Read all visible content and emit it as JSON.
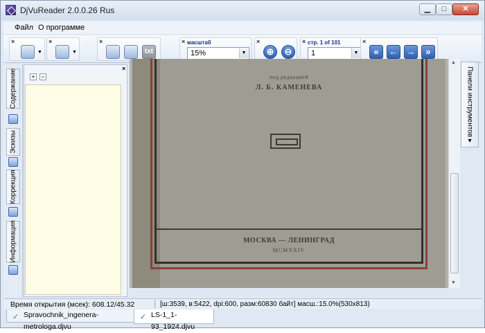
{
  "window": {
    "title": "DjVuReader 2.0.0.26 Rus",
    "min_glyph": "▁",
    "max_glyph": "□",
    "close_glyph": "✕"
  },
  "menu": {
    "items": [
      "Файл",
      "О программе"
    ]
  },
  "toolbar": {
    "scale_label": "масштаб",
    "scale_value": "15%",
    "page_label": "стр. 1 of 101",
    "page_value": "1",
    "txt_label": "txt",
    "close_glyph": "×",
    "icons": [
      "layout-icon",
      "page-icon",
      "single-page-icon",
      "image-icon",
      "text-icon",
      "zoom-in-icon",
      "zoom-out-icon",
      "first-page-icon",
      "prev-page-icon",
      "next-page-icon",
      "last-page-icon"
    ],
    "nav_glyphs": {
      "zoom_in": "⊕",
      "zoom_out": "⊖",
      "first": "«",
      "prev": "←",
      "next": "→",
      "last": "»"
    }
  },
  "sidebar": {
    "tabs": [
      {
        "label": "Содержание",
        "icon": "contents-icon"
      },
      {
        "label": "Эскизы",
        "icon": "thumbnails-icon"
      },
      {
        "label": "Коррекция",
        "icon": "correction-icon"
      },
      {
        "label": "Информация",
        "icon": "info-icon"
      }
    ],
    "expand_glyph": "+",
    "collapse_glyph": "−"
  },
  "right_panel": {
    "label": "Панели инструментов ▸"
  },
  "document": {
    "subtitle": "под редакцией",
    "editor": "Л. Б. КАМЕНЕВА",
    "city": "МОСКВА — ЛЕНИНГРАД",
    "year": "MCMXXIV"
  },
  "status": {
    "open_time": "Время открытия (мсек): 608.12/45.32",
    "page_info": "[ш:3539, в:5422, dpi:600, разм:60830 байт] масш.:15.0%(530x813)"
  },
  "doc_tabs": [
    {
      "label": "Spravochnik_ingenera-metrologa.djvu",
      "active": false
    },
    {
      "label": "LS-1_1-93_1924.djvu",
      "active": true
    }
  ],
  "colors": {
    "accent": "#2e5fb3",
    "page": "#9e9d94",
    "frame_red": "#8d3f39"
  }
}
